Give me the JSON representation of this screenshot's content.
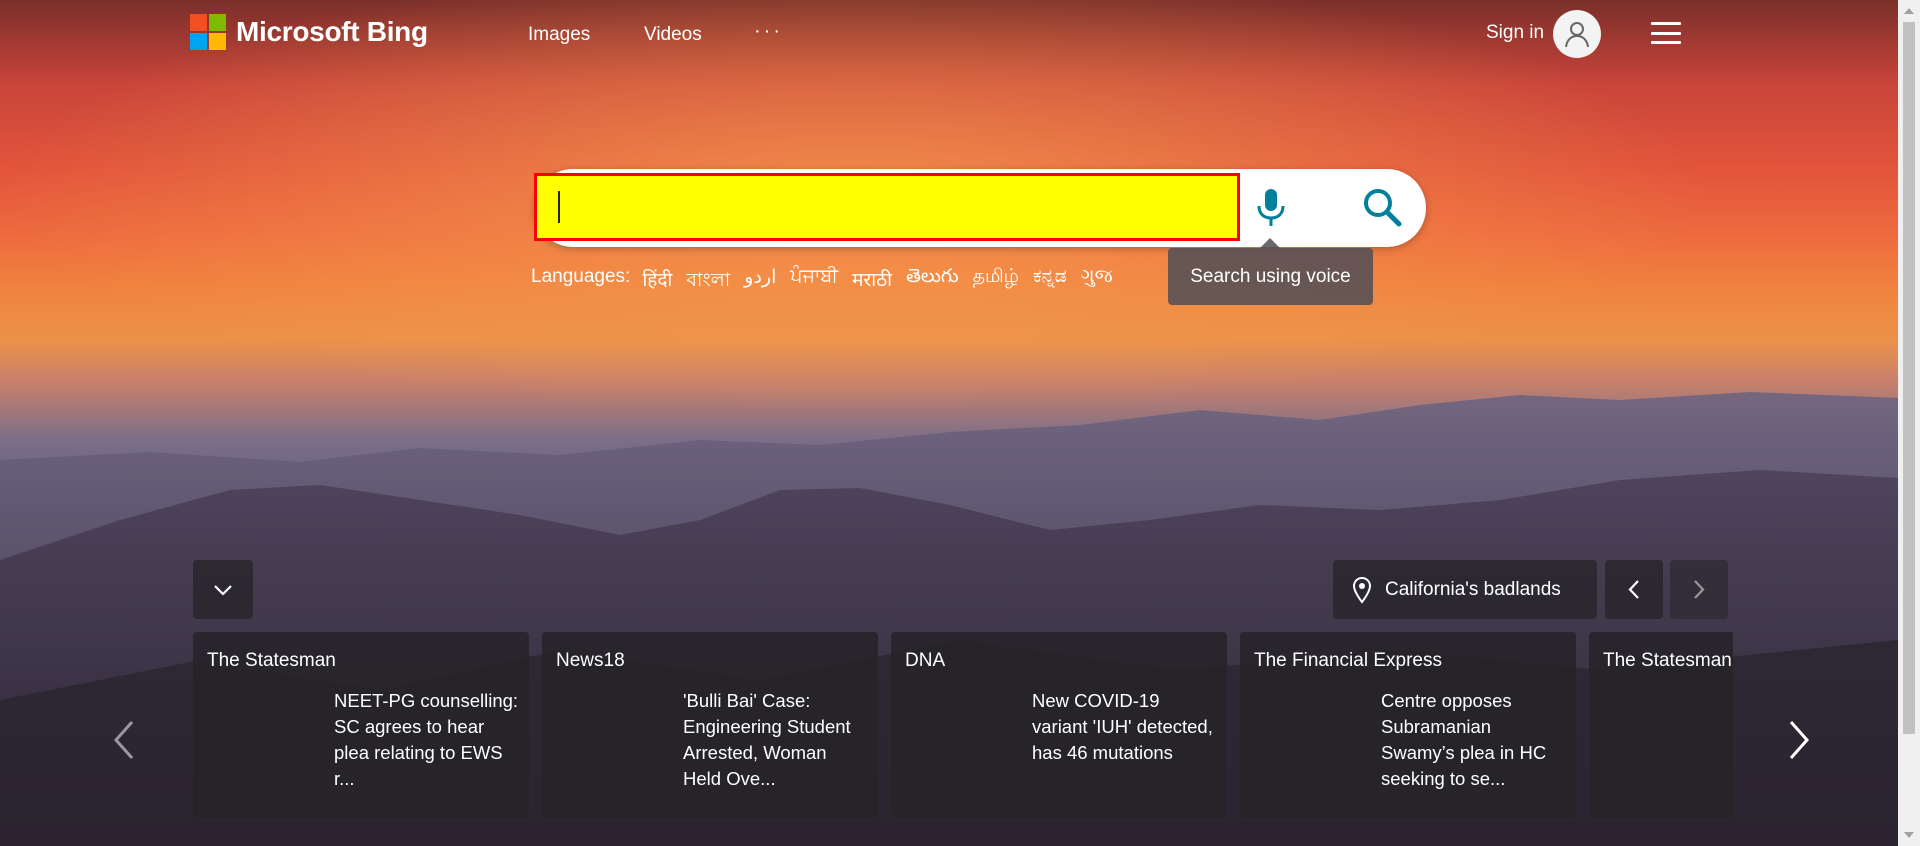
{
  "header": {
    "logo_text": "Microsoft Bing",
    "nav": [
      "Images",
      "Videos"
    ],
    "more_label": "···",
    "signin_label": "Sign in"
  },
  "search": {
    "value": "",
    "placeholder": "",
    "mic_tooltip": "Search using voice"
  },
  "languages": {
    "label": "Languages:",
    "items": [
      "हिंदी",
      "বাংলা",
      "اردو",
      "ਪੰਜਾਬੀ",
      "मराठी",
      "తెలుగు",
      "தமிழ்",
      "ಕನ್ನಡ",
      "ગુજ"
    ]
  },
  "image_info": {
    "location": "California's badlands"
  },
  "news": [
    {
      "source": "The Statesman",
      "headline": "NEET-PG counselling: SC agrees to hear plea relating to EWS r..."
    },
    {
      "source": "News18",
      "headline": "'Bulli Bai' Case: Engineering Student Arrested, Woman Held Ove..."
    },
    {
      "source": "DNA",
      "headline": "New COVID-19 variant 'IUH' detected, has 46 mutations"
    },
    {
      "source": "The Financial Express",
      "headline": "Centre opposes Subramanian Swamy’s plea in HC seeking to se..."
    },
    {
      "source": "The Statesman",
      "headline": ""
    }
  ],
  "colors": {
    "search_highlight": "#ffff00",
    "search_border": "#ff0000",
    "accent_icon": "#00809d"
  }
}
